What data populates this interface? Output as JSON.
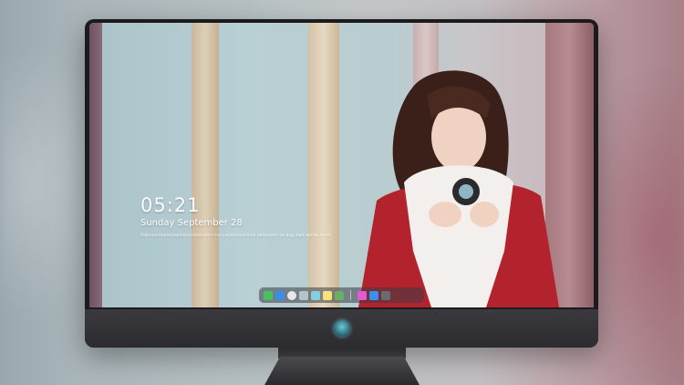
{
  "lock_screen": {
    "time": "05:21",
    "date": "Sunday September  28",
    "subtext": "Aalmaandnoamnamlacasdlamnalm cuna.acantacananal aalkanahn da ang dapt dpntla  tindd"
  },
  "dock": {
    "items": [
      {
        "name": "messages-icon",
        "color": "#46c35a"
      },
      {
        "name": "finder-icon",
        "color": "#3a8ee8"
      },
      {
        "name": "safari-icon",
        "color": "#e8e8ea"
      },
      {
        "name": "preview-icon",
        "color": "#b7c3cc"
      },
      {
        "name": "photos-icon",
        "color": "#7fd1e0"
      },
      {
        "name": "notes-icon",
        "color": "#f5e27a"
      },
      {
        "name": "maps-icon",
        "color": "#67b06a"
      },
      {
        "name": "music-icon",
        "color": "#e45ad1"
      },
      {
        "name": "app-store-icon",
        "color": "#3b8ff0"
      },
      {
        "name": "camera-icon",
        "color": "#6a6a70"
      }
    ]
  },
  "monitor": {
    "logo": "logo-icon"
  }
}
